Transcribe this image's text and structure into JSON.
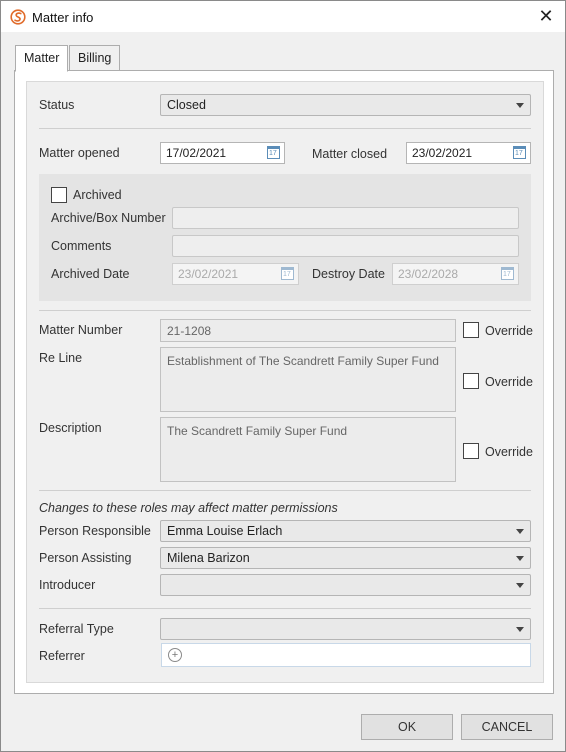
{
  "window": {
    "title": "Matter info",
    "close_symbol": "✕",
    "icon": "app-logo-icon"
  },
  "tabs": [
    {
      "label": "Matter",
      "active": true
    },
    {
      "label": "Billing",
      "active": false
    }
  ],
  "status": {
    "label": "Status",
    "value": "Closed"
  },
  "dates": {
    "opened_label": "Matter opened",
    "opened_value": "17/02/2021",
    "closed_label": "Matter closed",
    "closed_value": "23/02/2021"
  },
  "archive": {
    "archived_label": "Archived",
    "archived_checked": false,
    "box_number_label": "Archive/Box Number",
    "box_number_value": "",
    "comments_label": "Comments",
    "comments_value": "",
    "archived_date_label": "Archived Date",
    "archived_date_value": "23/02/2021",
    "destroy_date_label": "Destroy Date",
    "destroy_date_value": "23/02/2028"
  },
  "matter": {
    "number_label": "Matter Number",
    "number_value": "21-1208",
    "reline_label": "Re Line",
    "reline_value": "Establishment of The Scandrett Family Super Fund",
    "description_label": "Description",
    "description_value": "The Scandrett Family Super Fund",
    "override_label": "Override"
  },
  "roles": {
    "note": "Changes to these roles may affect matter permissions",
    "responsible_label": "Person Responsible",
    "responsible_value": "Emma Louise Erlach",
    "assisting_label": "Person Assisting",
    "assisting_value": "Milena Barizon",
    "introducer_label": "Introducer",
    "introducer_value": ""
  },
  "referral": {
    "type_label": "Referral Type",
    "type_value": "",
    "referrer_label": "Referrer",
    "add_symbol": "+"
  },
  "buttons": {
    "ok": "OK",
    "cancel": "CANCEL"
  },
  "colors": {
    "accent_logo": "#e06b2a",
    "calendar_icon": "#5b8db8"
  }
}
